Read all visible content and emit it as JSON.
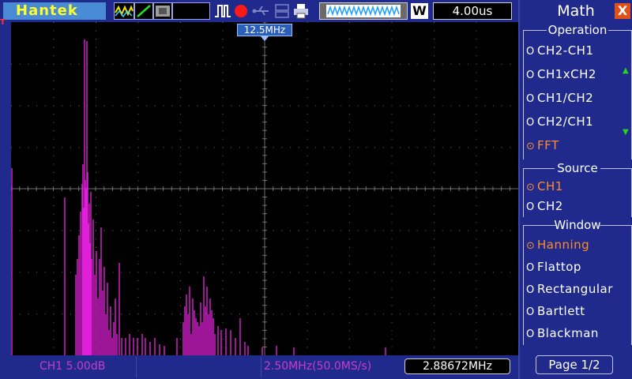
{
  "topbar": {
    "brand": "Hantek",
    "timebase": "4.00us",
    "mode_letter": "W",
    "icons": [
      "waveform-mode-icon",
      "edge-trigger-icon",
      "persist-icon",
      "pulse-icon",
      "record-icon",
      "usb-icon",
      "print-icon"
    ],
    "record_color": "#ff1a1a"
  },
  "screen": {
    "trigger_flag": "T",
    "marker_label": "12.5MHz",
    "trace_color": "#e020d8",
    "grid_color": "#6e6e6e"
  },
  "bottombar": {
    "ch1_scale": "CH1 5.00dB",
    "rate": "2.50MHz(50.0MS/s)",
    "freq": "2.88672MHz"
  },
  "menu": {
    "title": "Math",
    "close": "X",
    "operation": {
      "label": "Operation",
      "options": [
        "CH2-CH1",
        "CH1xCH2",
        "CH1/CH2",
        "CH2/CH1",
        "FFT"
      ],
      "selected": "FFT"
    },
    "source": {
      "label": "Source",
      "options": [
        "CH1",
        "CH2"
      ],
      "selected": "CH1"
    },
    "window": {
      "label": "Window",
      "options": [
        "Hanning",
        "Flattop",
        "Rectangular",
        "Bartlett",
        "Blackman"
      ],
      "selected": "Hanning"
    },
    "page": "Page 1/2",
    "radio_off": "O",
    "radio_on": "⊙"
  }
}
